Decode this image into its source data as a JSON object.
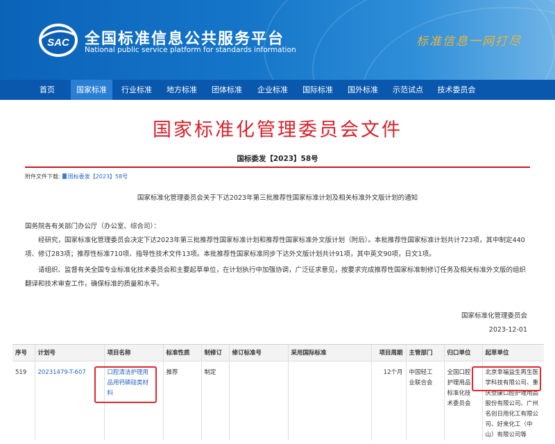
{
  "header": {
    "logo_text": "SAC",
    "title": "全国标准信息公共服务平台",
    "subtitle": "National public service platform  for standards information",
    "slogan": "标准信息一网打尽"
  },
  "nav": {
    "items": [
      "首页",
      "国家标准",
      "行业标准",
      "地方标准",
      "团体标准",
      "企业标准",
      "国际标准",
      "国外标准",
      "示范试点",
      "技术委员会"
    ],
    "active": "国家标准"
  },
  "document": {
    "title": "国家标准化管理委员会文件",
    "number": "国标委发【2023】58号",
    "attachment_label": "附件文件下载:",
    "attachment_link": "国标委发【2023】58号",
    "notice_title": "国家标准化管理委员会关于下达2023年第三批推荐性国家标准计划及相关标准外文版计划的通知",
    "addressee": "国务院各有关部门办公厅（办公室、综合司）：",
    "paragraph1": "经研究，国家标准化管理委员会决定下达2023年第三批推荐性国家标准计划和推荐性国家标准外文版计划（附后）。本批推荐性国家标准计划共计723项，其中制定440项、修订283项；推荐性标准710项、指导性技术文件13项。本批推荐性国家标准同步下达外文版计划共计91项，其中英文90项，日文1项。",
    "paragraph2": "请组织、监督有关全国专业标准化技术委员会和主要起草单位，在计划执行中加强协调，广泛征求意见，按要求完成推荐性国家标准制修订任务及相关标准外文版的组织翻译和技术审查工作，确保标准的质量和水平。",
    "issuer": "国家标准化管理委员会",
    "date": "2023-12-01"
  },
  "table": {
    "headers": [
      "序号",
      "计划号",
      "项目名称",
      "标准性质",
      "制修订",
      "修订标准号",
      "采用国际标准",
      "项目周期",
      "主管部门",
      "归口单位",
      "起草单位"
    ],
    "rows": [
      {
        "index": "519",
        "plan_no": "20231479-T-607",
        "name_lines": [
          "口腔清洁护理用",
          "品用钙磷硅类材",
          "料"
        ],
        "nature": "推荐",
        "type": "制定",
        "revised_std": "",
        "intl_std": "",
        "cycle": "12个月",
        "dept_lines": [
          "中国轻工",
          "业联合会"
        ],
        "tc_lines": [
          "全国口腔",
          "护理用品",
          "标准化技",
          "术委员会"
        ],
        "drafter_lines": [
          "北京幸福益生再生医",
          "学科技有限公司、重",
          "庆登康口腔护理用品",
          "股份有限公司、广州",
          "名创日用化工有限公",
          "司、好来化工（中",
          "山）有限公司等"
        ]
      }
    ]
  },
  "colors": {
    "banner_blue": "#1576c9",
    "nav_blue": "#0a58ad",
    "title_red": "#d6202b",
    "highlight_red": "#e0252b",
    "link_blue": "#2566c6"
  }
}
